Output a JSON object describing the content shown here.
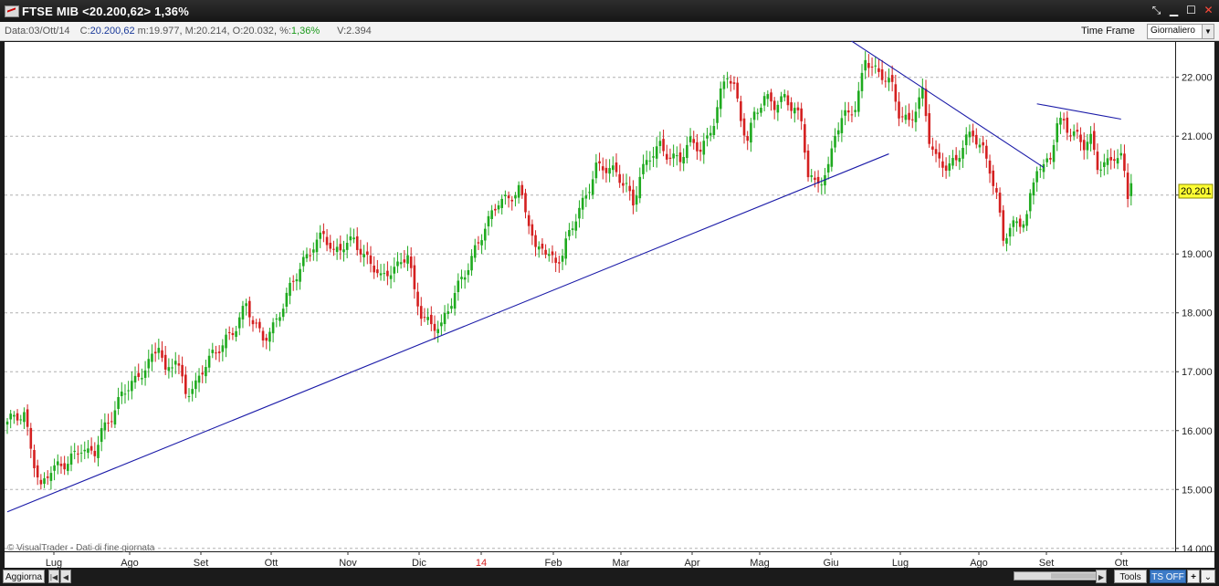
{
  "window": {
    "title": "FTSE MIB <20.200,62> 1,36%",
    "buttons": {
      "pin": "⤡",
      "minimize": "▁",
      "maximize": "☐",
      "close": "✕"
    }
  },
  "info": {
    "date_label": "Data:",
    "date": "03/Ott/14",
    "close_label": "C:",
    "close": "20.200,62",
    "min_label": "m:",
    "min": "19.977",
    "max_label": "M:",
    "max": "20.214",
    "open_label": "O:",
    "open": "20.032",
    "pct_label": "%:",
    "pct": "1,36%",
    "vol_label": "V:",
    "vol": "2.394",
    "time_frame_label": "Time Frame",
    "time_frame_value": "Giornaliero"
  },
  "bottom": {
    "aggiorna": "Aggiorna",
    "tools": "Tools",
    "ts_off": "TS OFF",
    "plus": "+",
    "chevron": "⌄"
  },
  "chart_data": {
    "type": "candlestick",
    "watermark": "© VisualTrader - Dati di fine giornata",
    "ylim": [
      13.95,
      22.6
    ],
    "y_ticks": [
      "14.000",
      "15.000",
      "16.000",
      "17.000",
      "18.000",
      "19.000",
      "20.000",
      "21.000",
      "22.000"
    ],
    "y_tick_values": [
      14,
      15,
      16,
      17,
      18,
      19,
      20,
      21,
      22
    ],
    "x_labels": [
      "Lug",
      "Ago",
      "Set",
      "Ott",
      "Nov",
      "Dic",
      "14",
      "Feb",
      "Mar",
      "Apr",
      "Mag",
      "Giu",
      "Lug",
      "Ago",
      "Set",
      "Ott"
    ],
    "x_label_highlight": "14",
    "last_price_label": "20.201",
    "last_price_value": 20.201,
    "colors": {
      "up": "#1faa1f",
      "down": "#d42020",
      "trendline": "#1a1aa8",
      "grid": "#b0b0b0",
      "price_tag": "#ffff33",
      "year_label": "#d42020"
    },
    "gridlines": "horizontal dashed",
    "trendlines": [
      {
        "from": [
          0,
          14.62
        ],
        "to": [
          262,
          20.7
        ]
      },
      {
        "from": [
          250,
          22.65
        ],
        "to": [
          308,
          20.47
        ]
      },
      {
        "from": [
          306,
          21.55
        ],
        "to": [
          331,
          21.29
        ]
      }
    ],
    "anchors": [
      [
        0,
        16.1
      ],
      [
        5,
        16.3
      ],
      [
        8,
        15.5
      ],
      [
        10,
        15.0
      ],
      [
        13,
        15.3
      ],
      [
        16,
        15.4
      ],
      [
        19,
        15.6
      ],
      [
        22,
        15.7
      ],
      [
        24,
        15.55
      ],
      [
        26,
        15.6
      ],
      [
        28,
        16.0
      ],
      [
        31,
        16.3
      ],
      [
        34,
        16.6
      ],
      [
        38,
        16.8
      ],
      [
        42,
        17.2
      ],
      [
        45,
        17.5
      ],
      [
        47,
        16.9
      ],
      [
        50,
        17.2
      ],
      [
        53,
        16.7
      ],
      [
        56,
        16.8
      ],
      [
        59,
        17.1
      ],
      [
        62,
        17.3
      ],
      [
        65,
        17.6
      ],
      [
        68,
        17.8
      ],
      [
        71,
        18.1
      ],
      [
        73,
        17.8
      ],
      [
        76,
        17.6
      ],
      [
        79,
        17.8
      ],
      [
        82,
        18.1
      ],
      [
        85,
        18.5
      ],
      [
        88,
        18.9
      ],
      [
        91,
        19.2
      ],
      [
        94,
        19.3
      ],
      [
        97,
        18.95
      ],
      [
        100,
        19.2
      ],
      [
        103,
        19.3
      ],
      [
        106,
        18.9
      ],
      [
        108,
        18.8
      ],
      [
        111,
        18.6
      ],
      [
        113,
        18.75
      ],
      [
        116,
        18.8
      ],
      [
        119,
        18.95
      ],
      [
        121,
        18.3
      ],
      [
        123,
        18.0
      ],
      [
        126,
        17.85
      ],
      [
        129,
        17.75
      ],
      [
        131,
        18.0
      ],
      [
        133,
        18.3
      ],
      [
        135,
        18.6
      ],
      [
        137,
        18.85
      ],
      [
        139,
        19.1
      ],
      [
        141,
        19.3
      ],
      [
        143,
        19.5
      ],
      [
        146,
        19.9
      ],
      [
        149,
        20.0
      ],
      [
        152,
        20.1
      ],
      [
        155,
        19.5
      ],
      [
        157,
        19.0
      ],
      [
        159,
        19.2
      ],
      [
        161,
        19.0
      ],
      [
        163,
        18.9
      ],
      [
        165,
        18.95
      ],
      [
        167,
        19.3
      ],
      [
        169,
        19.6
      ],
      [
        171,
        19.9
      ],
      [
        173,
        20.2
      ],
      [
        175,
        20.5
      ],
      [
        178,
        20.4
      ],
      [
        181,
        20.35
      ],
      [
        184,
        20.2
      ],
      [
        186,
        19.9
      ],
      [
        188,
        20.3
      ],
      [
        191,
        20.6
      ],
      [
        194,
        20.85
      ],
      [
        197,
        20.7
      ],
      [
        200,
        20.6
      ],
      [
        203,
        20.85
      ],
      [
        206,
        20.8
      ],
      [
        208,
        21.0
      ],
      [
        210,
        21.3
      ],
      [
        212,
        21.7
      ],
      [
        214,
        22.0
      ],
      [
        216,
        21.8
      ],
      [
        218,
        21.3
      ],
      [
        220,
        21.0
      ],
      [
        222,
        21.4
      ],
      [
        225,
        21.6
      ],
      [
        228,
        21.5
      ],
      [
        231,
        21.7
      ],
      [
        234,
        21.5
      ],
      [
        236,
        21.2
      ],
      [
        238,
        20.3
      ],
      [
        240,
        20.15
      ],
      [
        242,
        20.3
      ],
      [
        244,
        20.5
      ],
      [
        246,
        21.1
      ],
      [
        249,
        21.3
      ],
      [
        252,
        21.45
      ],
      [
        253,
        21.7
      ],
      [
        255,
        22.4
      ],
      [
        257,
        22.2
      ],
      [
        260,
        22.0
      ],
      [
        263,
        21.8
      ],
      [
        265,
        21.4
      ],
      [
        268,
        21.3
      ],
      [
        271,
        21.6
      ],
      [
        272,
        21.7
      ],
      [
        274,
        20.9
      ],
      [
        276,
        20.6
      ],
      [
        279,
        20.55
      ],
      [
        282,
        20.6
      ],
      [
        285,
        20.9
      ],
      [
        287,
        21.0
      ],
      [
        290,
        20.8
      ],
      [
        292,
        20.5
      ],
      [
        294,
        20.0
      ],
      [
        295,
        19.6
      ],
      [
        296,
        19.2
      ],
      [
        298,
        19.4
      ],
      [
        301,
        19.55
      ],
      [
        303,
        19.7
      ],
      [
        304,
        20.0
      ],
      [
        306,
        20.5
      ],
      [
        308,
        20.4
      ],
      [
        310,
        20.6
      ],
      [
        312,
        21.2
      ],
      [
        314,
        21.3
      ],
      [
        316,
        21.1
      ],
      [
        318,
        21.0
      ],
      [
        320,
        20.8
      ],
      [
        322,
        20.9
      ],
      [
        324,
        20.5
      ],
      [
        327,
        20.6
      ],
      [
        329,
        20.7
      ],
      [
        331,
        20.6
      ],
      [
        332,
        20.3
      ],
      [
        333,
        19.93
      ],
      [
        334,
        20.2
      ]
    ]
  }
}
